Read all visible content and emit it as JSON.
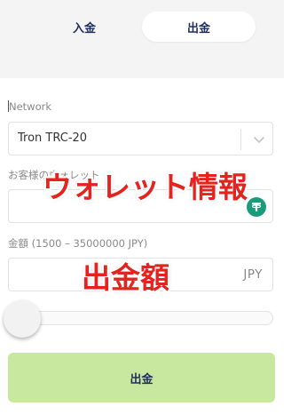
{
  "tabs": {
    "deposit_label": "入金",
    "withdraw_label": "出金",
    "active": "withdraw"
  },
  "network": {
    "label": "Network",
    "selected": "Tron TRC-20"
  },
  "wallet": {
    "label": "お客様のウォレット",
    "value": "",
    "icon": "tether-icon"
  },
  "amount": {
    "label": "金額 (1500 – 35000000 JPY)",
    "value": "",
    "unit": "JPY"
  },
  "slider": {
    "level": 0
  },
  "annotations": {
    "wallet_info": "ウォレット情報",
    "withdraw_amount": "出金額"
  },
  "submit_label": "出金",
  "colors": {
    "accent_green": "#c8e89f",
    "tab_text": "#1f2d5c",
    "tether_green": "#1a9b7b",
    "annotation_red": "#e4221e"
  }
}
